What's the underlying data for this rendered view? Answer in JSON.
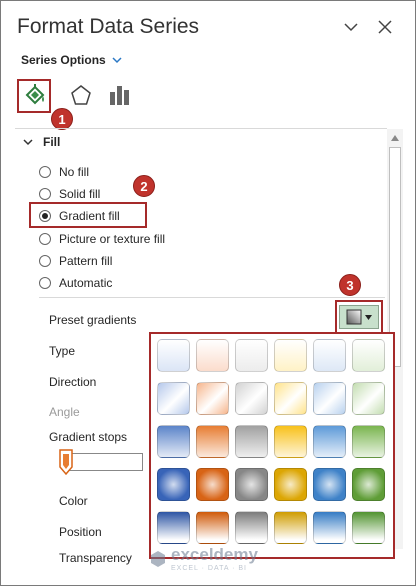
{
  "header": {
    "title": "Format Data Series"
  },
  "series_options": {
    "label": "Series Options"
  },
  "tabs": [
    {
      "name": "fill-line",
      "icon": "paint-bucket-icon"
    },
    {
      "name": "effects",
      "icon": "pentagon-icon"
    },
    {
      "name": "series-options",
      "icon": "bar-chart-icon"
    }
  ],
  "badges": [
    "1",
    "2",
    "3"
  ],
  "fill": {
    "section_label": "Fill",
    "options": [
      {
        "label": "No fill",
        "selected": false
      },
      {
        "label": "Solid fill",
        "selected": false
      },
      {
        "label": "Gradient fill",
        "selected": true
      },
      {
        "label": "Picture or texture fill",
        "selected": false
      },
      {
        "label": "Pattern fill",
        "selected": false
      },
      {
        "label": "Automatic",
        "selected": false
      }
    ]
  },
  "properties": {
    "preset_gradients": "Preset gradients",
    "type": "Type",
    "direction": "Direction",
    "angle": "Angle",
    "gradient_stops": "Gradient stops",
    "color": "Color",
    "position": "Position",
    "transparency": "Transparency"
  },
  "preset_palette": {
    "columns": [
      {
        "name": "blue",
        "shades": [
          "#dbe5f6",
          "#b5c8eb",
          "#5b84c9",
          "#3864b8",
          "#2d55a4"
        ]
      },
      {
        "name": "orange",
        "shades": [
          "#fbdccc",
          "#f6b58c",
          "#e77d32",
          "#d86416",
          "#cf5a09"
        ]
      },
      {
        "name": "gray",
        "shades": [
          "#ececec",
          "#d2d2d2",
          "#a1a1a1",
          "#878787",
          "#7b7b7b"
        ]
      },
      {
        "name": "gold",
        "shades": [
          "#fff2c6",
          "#ffe38a",
          "#f8c11a",
          "#dca604",
          "#cf9c00"
        ]
      },
      {
        "name": "light-blue",
        "shades": [
          "#dde8f6",
          "#b8d1ee",
          "#5d9ad8",
          "#3f82c8",
          "#357bc4"
        ]
      },
      {
        "name": "green",
        "shades": [
          "#e2efd9",
          "#c3ddb0",
          "#7ab54f",
          "#5f9d37",
          "#519330"
        ]
      }
    ]
  },
  "watermark": {
    "name": "exceldemy",
    "tagline": "EXCEL · DATA · BI"
  },
  "colors": {
    "accent_red": "#a52a2a",
    "badge_red": "#c0332c",
    "fill_green": "#3a8d4a"
  }
}
